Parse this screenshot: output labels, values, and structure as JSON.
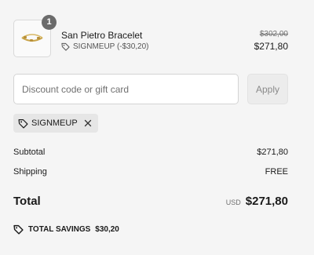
{
  "product": {
    "name": "San Pietro Bracelet",
    "quantity": "1",
    "discount_label": "SIGNMEUP (-$30,20)",
    "original_price": "$302,00",
    "price": "$271,80"
  },
  "discount": {
    "placeholder": "Discount code or gift card",
    "apply_label": "Apply",
    "applied_code": "SIGNMEUP"
  },
  "summary": {
    "subtotal_label": "Subtotal",
    "subtotal_value": "$271,80",
    "shipping_label": "Shipping",
    "shipping_value": "FREE",
    "total_label": "Total",
    "currency": "USD",
    "total_value": "$271,80",
    "savings_label": "TOTAL SAVINGS",
    "savings_value": "$30,20"
  },
  "icons": {
    "tag": "tag-icon",
    "close": "close-icon",
    "savings": "price-tag-icon"
  }
}
